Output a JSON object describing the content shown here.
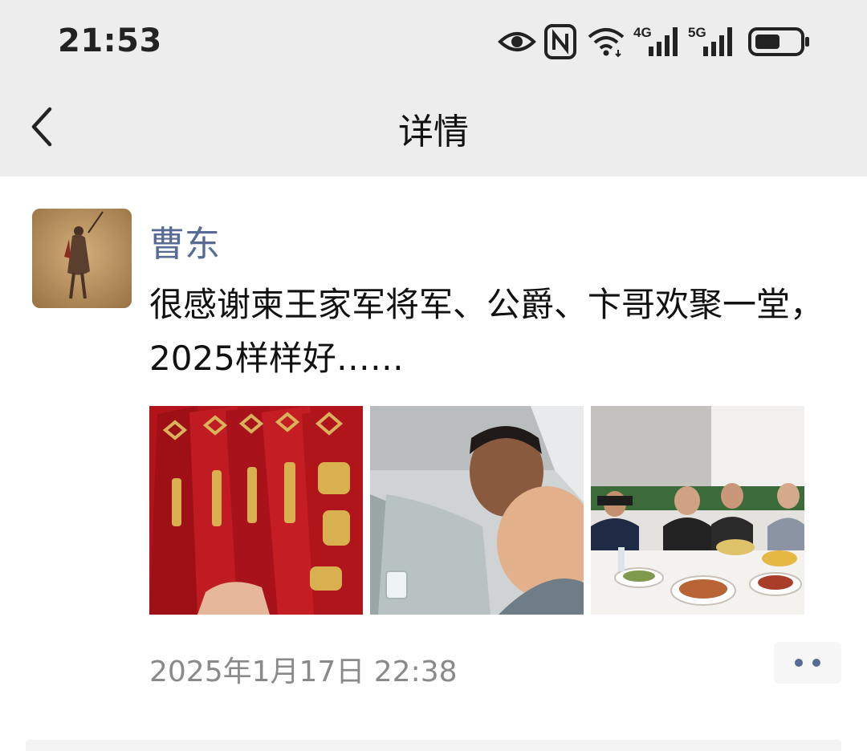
{
  "status_bar": {
    "time": "21:53",
    "network_4g": "4G",
    "network_5g": "5G",
    "icons": [
      "eye-icon",
      "nfc-icon",
      "wifi-icon",
      "signal-4g-icon",
      "signal-5g-icon",
      "battery-icon"
    ]
  },
  "nav": {
    "title": "详情",
    "back_icon": "chevron-left-icon"
  },
  "post": {
    "author": "曹东",
    "text": "很感谢柬王家军将军、公爵、卞哥欢聚一堂，2025样样好……",
    "photos": [
      {
        "name": "red-envelopes-photo"
      },
      {
        "name": "two-men-selfie-photo"
      },
      {
        "name": "dinner-table-photo"
      }
    ],
    "timestamp": "2025年1月17日 22:38",
    "more_icon": "more-dots-icon"
  },
  "colors": {
    "topbar_bg": "#ededed",
    "author_link": "#576b95",
    "timestamp": "#8a8a8a"
  }
}
